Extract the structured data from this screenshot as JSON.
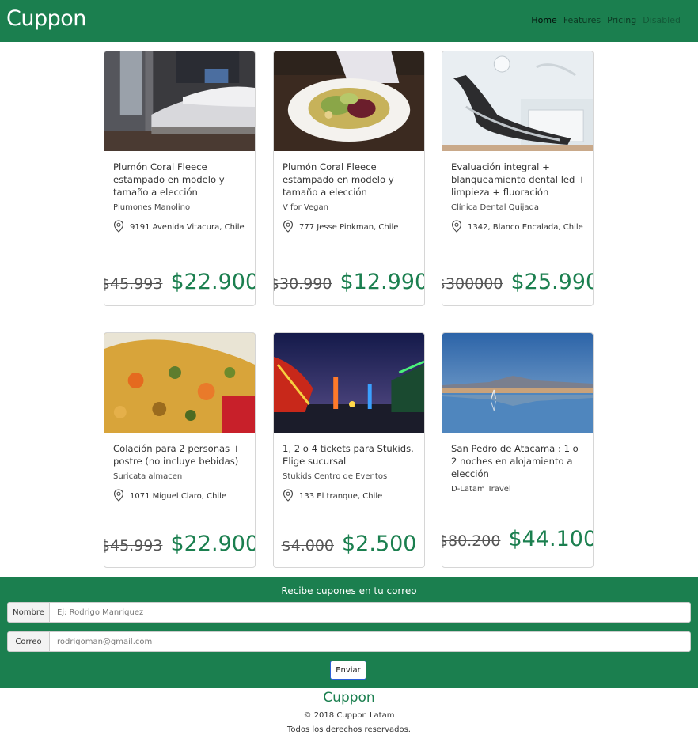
{
  "nav": {
    "brand": "Cuppon",
    "links": [
      "Home",
      "Features",
      "Pricing",
      "Disabled"
    ]
  },
  "cards": [
    {
      "title": "Plumón Coral Fleece estampado en modelo y tamaño a elección",
      "merchant": "Plumones Manolino",
      "location": "9191 Avenida Vitacura, Chile",
      "old_price": "$45.993",
      "new_price": "$22.900"
    },
    {
      "title": "Plumón Coral Fleece estampado en modelo y tamaño a elección",
      "merchant": "V for Vegan",
      "location": "777 Jesse Pinkman, Chile",
      "old_price": "$30.990",
      "new_price": "$12.990"
    },
    {
      "title": "Evaluación integral + blanqueamiento dental led + limpieza + fluoración",
      "merchant": "Clínica Dental Quijada",
      "location": "1342, Blanco Encalada, Chile",
      "old_price": "$300000",
      "new_price": "$25.990"
    },
    {
      "title": "Colación para 2 personas + postre (no incluye bebidas)",
      "merchant": "Suricata almacen",
      "location": "1071 Miguel Claro, Chile",
      "old_price": "$45.993",
      "new_price": "$22.900"
    },
    {
      "title": "1, 2 o 4 tickets para Stukids. Elige sucursal",
      "merchant": "Stukids Centro de Eventos",
      "location": "133 El tranque, Chile",
      "old_price": "$4.000",
      "new_price": "$2.500"
    },
    {
      "title": "San Pedro de Atacama : 1 o 2 noches en alojamiento a elección",
      "merchant": "D-Latam Travel",
      "location": "",
      "old_price": "$80.200",
      "new_price": "$44.100"
    }
  ],
  "subscribe": {
    "title": "Recibe cupones en tu correo",
    "name_label": "Nombre",
    "name_placeholder": "Ej: Rodrigo Manriquez",
    "email_label": "Correo",
    "email_placeholder": "rodrigoman@gmail.com",
    "button": "Enviar"
  },
  "footer": {
    "brand": "Cuppon",
    "copyright": "© 2018 Cuppon Latam",
    "rights": "Todos los derechos reservados."
  },
  "colors": {
    "brand_green": "#1b7f4f"
  }
}
